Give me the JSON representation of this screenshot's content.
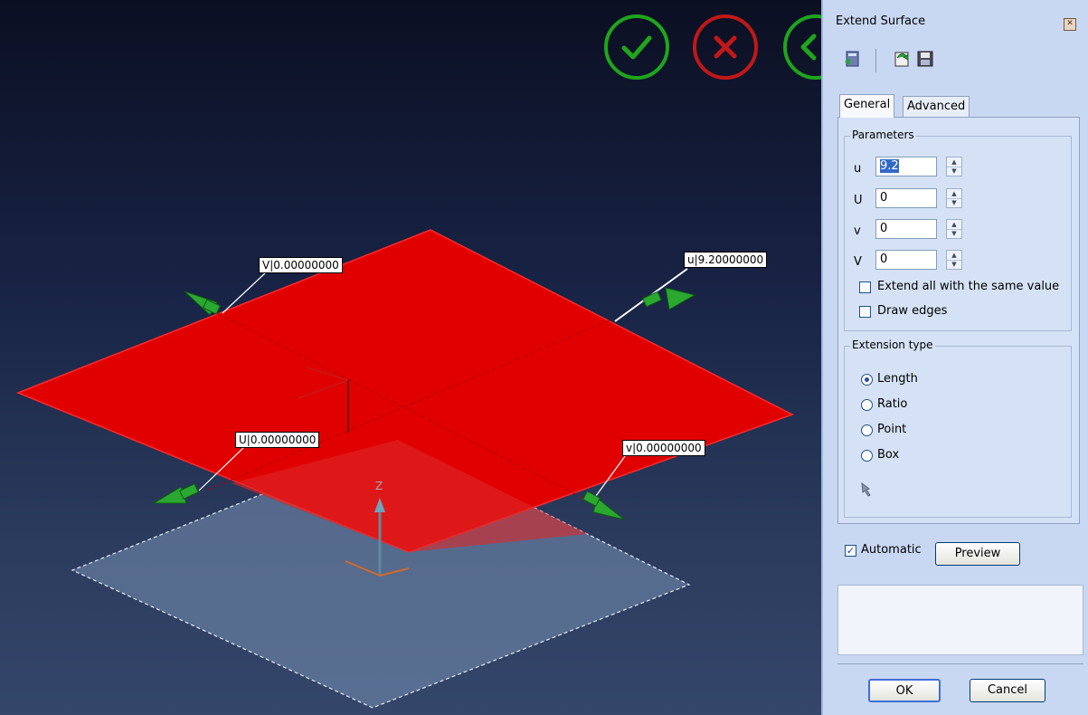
{
  "viewport": {
    "dim_labels": {
      "V": "V|0.00000000",
      "u": "u|9.20000000",
      "U": "U|0.00000000",
      "v": "v|0.00000000"
    },
    "axis_z": "Z",
    "buttons": {
      "accept_icon": "check-icon",
      "cancel_icon": "x-icon",
      "back_icon": "back-arrow-icon"
    },
    "colors": {
      "surface": "#e00000",
      "accept": "#22a020",
      "cancel": "#c01818"
    }
  },
  "panel": {
    "title": "Extend Surface",
    "close": "✕",
    "toolbar_icons": [
      "reset-icon",
      "refresh-icon",
      "save-icon"
    ],
    "tabs": [
      "General",
      "Advanced"
    ],
    "parameters": {
      "label": "Parameters",
      "u_label": "u",
      "u_value": "9.2",
      "U_label": "U",
      "U_value": "0",
      "v_label": "v",
      "v_value": "0",
      "V_label": "V",
      "V_value": "0"
    },
    "extend_all_label": "Extend all with the same value",
    "extend_all_checked": false,
    "draw_edges_label": "Draw edges",
    "draw_edges_checked": false,
    "extension_type": {
      "label": "Extension type",
      "options": [
        "Length",
        "Ratio",
        "Point",
        "Box"
      ],
      "selected": "Length"
    },
    "automatic_label": "Automatic",
    "automatic_checked": true,
    "automatic_mark": "✓",
    "preview_label": "Preview",
    "ok_label": "OK",
    "cancel_label": "Cancel"
  }
}
